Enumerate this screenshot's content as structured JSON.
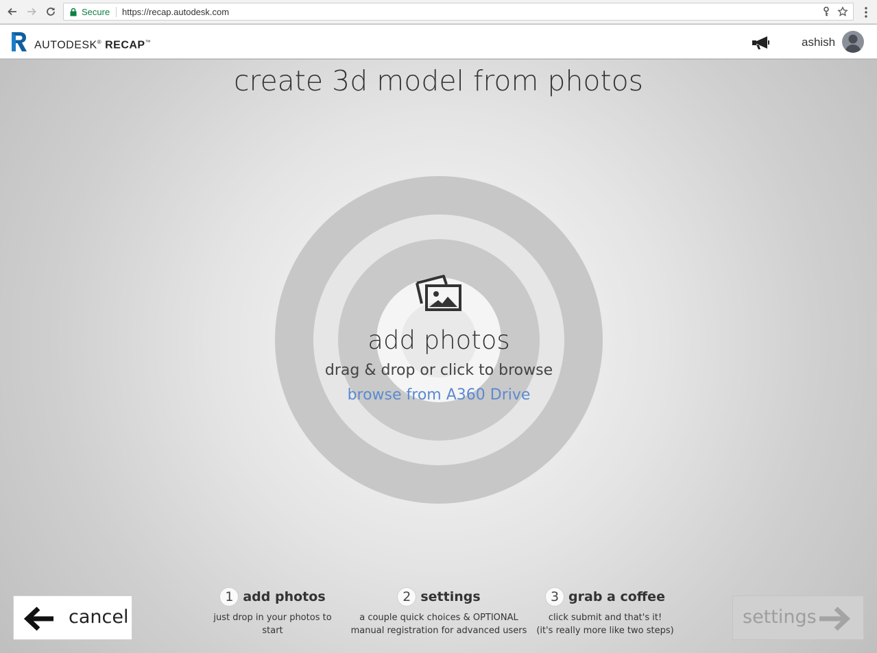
{
  "browser": {
    "secure_label": "Secure",
    "url": "https://recap.autodesk.com"
  },
  "app": {
    "brand_light": "AUTODESK",
    "brand_strong": "RECAP",
    "username": "ashish"
  },
  "page": {
    "title": "create 3d model from photos"
  },
  "drop_zone": {
    "title": "add photos",
    "hint": "drag & drop or click to browse",
    "link": "browse from A360 Drive"
  },
  "steps": [
    {
      "number": "1",
      "title": "add photos",
      "desc_line1": "just drop in your photos to start",
      "desc_line2": ""
    },
    {
      "number": "2",
      "title": "settings",
      "desc_line1": "a couple quick choices & OPTIONAL",
      "desc_line2": "manual registration for advanced users"
    },
    {
      "number": "3",
      "title": "grab a coffee",
      "desc_line1": "click submit and that's it!",
      "desc_line2": "(it's really more like two steps)"
    }
  ],
  "buttons": {
    "cancel": "cancel",
    "next": "settings"
  },
  "icons": {
    "back": "arrow-left-icon",
    "forward": "arrow-right-icon",
    "reload": "reload-icon",
    "lock": "lock-icon",
    "key": "key-icon",
    "star": "star-icon",
    "menu": "more-vert-icon",
    "announce": "megaphone-icon",
    "photos": "photos-icon"
  },
  "colors": {
    "secure": "#0b8043",
    "link": "#5b8ad0",
    "brand_r": "#0f5f9e",
    "disabled_button": "#d0d0d0"
  }
}
